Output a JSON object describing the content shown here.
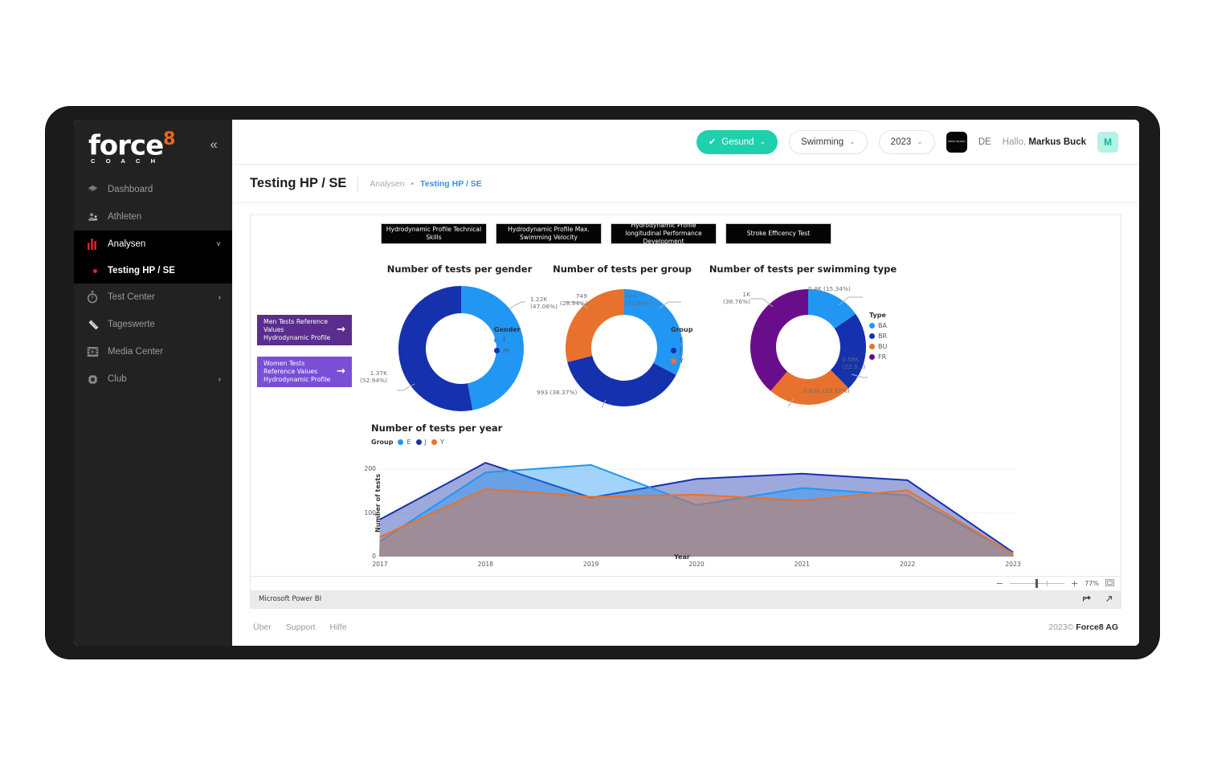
{
  "sidebar": {
    "logo_text": "force",
    "logo_sup": "8",
    "logo_sub": "C O A C H",
    "collapse_icon": "chevron-double-left",
    "items": [
      {
        "label": "Dashboard",
        "icon": "dashboard-icon",
        "chevron": ""
      },
      {
        "label": "Athleten",
        "icon": "athlete-icon",
        "chevron": ""
      },
      {
        "label": "Analysen",
        "icon": "analytics-bars-icon",
        "chevron": "˅"
      },
      {
        "label": "Test Center",
        "icon": "stopwatch-icon",
        "chevron": "›"
      },
      {
        "label": "Tageswerte",
        "icon": "ruler-icon",
        "chevron": ""
      },
      {
        "label": "Media Center",
        "icon": "film-icon",
        "chevron": ""
      },
      {
        "label": "Club",
        "icon": "club-gear-icon",
        "chevron": "›"
      }
    ],
    "sub_item": {
      "label": "Testing HP / SE"
    }
  },
  "topbar": {
    "status": {
      "label": "Gesund",
      "check": "✔",
      "caret": "⌄",
      "color": "#1ed0ac"
    },
    "sport": {
      "label": "Swimming",
      "caret": "⌄"
    },
    "year": {
      "label": "2023",
      "caret": "⌄"
    },
    "club_logo_text": "SWIM SQUAD",
    "language": "DE",
    "greeting_prefix": "Hallo, ",
    "user_name": "Markus Buck",
    "avatar_initial": "M"
  },
  "page": {
    "title": "Testing HP / SE",
    "breadcrumb_root": "Analysen",
    "breadcrumb_sep": "•",
    "breadcrumb_current": "Testing HP / SE"
  },
  "report": {
    "tabs": [
      "Hydrodynamic Profile Technical Skills",
      "Hydrodynamic Profile Max. Swimming Velocity",
      "Hydrodynamic Profile longitudinal Performance Development",
      "Stroke Efficency Test"
    ],
    "link_buttons": [
      {
        "line1": "Men Tests Reference Values",
        "line2": "Hydrodynamic Profile",
        "arrow": "→",
        "color": "#5b2d8e"
      },
      {
        "line1": "Women Tests Reference Values",
        "line2": "Hydrodynamic Profile",
        "arrow": "→",
        "color": "#7a4fd6"
      }
    ],
    "zoom": {
      "minus": "−",
      "plus": "+",
      "level": "77%",
      "fit_icon": "fit-to-screen-icon"
    },
    "footer": {
      "brand": "Microsoft Power BI",
      "share_icon": "share-icon",
      "fullscreen_icon": "expand-icon"
    }
  },
  "footer": {
    "links": [
      "Über",
      "Support",
      "Hilfe"
    ],
    "copyright_year": "2023©",
    "company": "Force8 AG"
  },
  "chart_data": [
    {
      "type": "pie",
      "title": "Number of tests per gender",
      "legend_title": "Gender",
      "legend_position": "right",
      "categories": [
        "f",
        "m"
      ],
      "values": [
        1220,
        1370
      ],
      "value_labels": [
        "1.22K",
        "1.37K"
      ],
      "percent_labels": [
        "(47.06%)",
        "(52.94%)"
      ],
      "percents": [
        47.06,
        52.94
      ],
      "colors": [
        "#2196f3",
        "#1531ad"
      ]
    },
    {
      "type": "pie",
      "title": "Number of tests per group",
      "legend_title": "Group",
      "legend_position": "right",
      "categories": [
        "E",
        "J",
        "Y"
      ],
      "values": [
        846,
        993,
        749
      ],
      "value_labels": [
        "846",
        "993",
        "749"
      ],
      "percent_labels": [
        "(32.69%)",
        "(38.37%)",
        "(28.94%)"
      ],
      "percents": [
        32.69,
        38.37,
        28.94
      ],
      "colors": [
        "#2196f3",
        "#1531ad",
        "#e8712d"
      ]
    },
    {
      "type": "pie",
      "title": "Number of tests per swimming type",
      "legend_title": "Type",
      "legend_position": "right",
      "categories": [
        "BA",
        "BR",
        "BU",
        "FR"
      ],
      "values": [
        400,
        580,
        610,
        1000
      ],
      "value_labels": [
        "0.4K",
        "0.58K",
        "0.61K",
        "1K"
      ],
      "percent_labels": [
        "(15.34%)",
        "(22.3...)",
        "(23.57%)",
        "(38.76%)"
      ],
      "percents": [
        15.34,
        22.33,
        23.57,
        38.76
      ],
      "colors": [
        "#2196f3",
        "#1531ad",
        "#e8712d",
        "#6a0d8a"
      ]
    },
    {
      "type": "area",
      "title": "Number of tests per year",
      "legend_title": "Group",
      "legend_position": "top",
      "xlabel": "Year",
      "ylabel": "Number of tests",
      "categories": [
        "2017",
        "2018",
        "2019",
        "2020",
        "2021",
        "2022",
        "2023"
      ],
      "yticks": [
        0,
        100,
        200
      ],
      "ylim": [
        0,
        230
      ],
      "grid": true,
      "series": [
        {
          "name": "E",
          "color": "#2196f3",
          "values": [
            35,
            193,
            210,
            118,
            157,
            140,
            8
          ]
        },
        {
          "name": "J",
          "color": "#1531ad",
          "values": [
            85,
            215,
            135,
            178,
            190,
            175,
            10
          ]
        },
        {
          "name": "Y",
          "color": "#e8712d",
          "values": [
            45,
            155,
            137,
            142,
            128,
            152,
            6
          ]
        }
      ]
    }
  ]
}
